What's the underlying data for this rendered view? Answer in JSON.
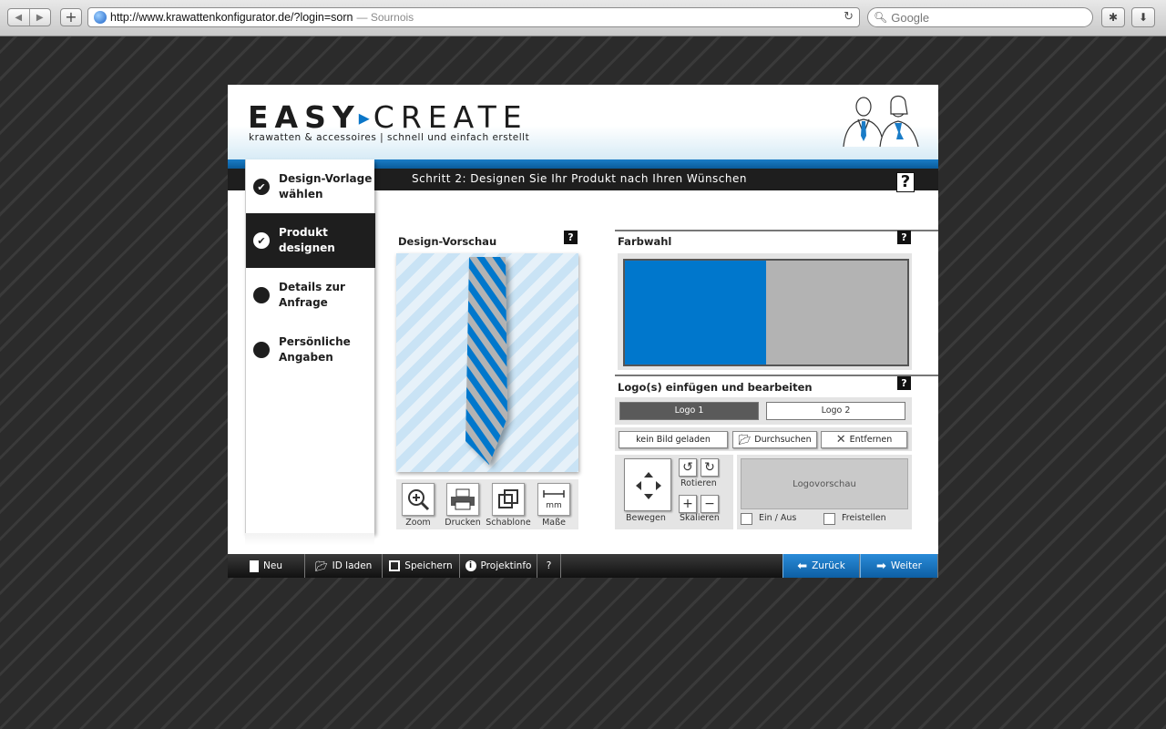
{
  "browser": {
    "url": "http://www.krawattenkonfigurator.de/?login=sorn",
    "title": "— Sournois",
    "search_placeholder": "Google"
  },
  "header": {
    "logo_easy": "EASY",
    "logo_create": "CREATE",
    "tagline": "krawatten & accessoires | schnell und einfach erstellt"
  },
  "step_title": "Schritt 2: Designen Sie Ihr Produkt nach Ihren Wünschen",
  "help_label": "?",
  "sidebar": {
    "items": [
      {
        "label_1": "Design-Vorlage",
        "label_2": "wählen",
        "state": "done"
      },
      {
        "label_1": "Produkt",
        "label_2": "designen",
        "state": "active"
      },
      {
        "label_1": "Details zur",
        "label_2": "Anfrage",
        "state": "pending"
      },
      {
        "label_1": "Persönliche",
        "label_2": "Angaben",
        "state": "pending"
      }
    ]
  },
  "preview": {
    "title": "Design-Vorschau",
    "tools": [
      "Zoom",
      "Drucken",
      "Schablone",
      "Maße"
    ],
    "mm_label": "mm"
  },
  "color": {
    "title": "Farbwahl",
    "swatch_a": "#0077cc",
    "swatch_b": "#b3b3b3"
  },
  "logos": {
    "title": "Logo(s) einfügen und bearbeiten",
    "tab_1": "Logo 1",
    "tab_2": "Logo 2",
    "file_status": "kein Bild geladen",
    "browse": "Durchsuchen",
    "remove": "Entfernen",
    "move": "Bewegen",
    "rotate": "Rotieren",
    "scale": "Skalieren",
    "preview": "Logovorschau",
    "toggle": "Ein / Aus",
    "cutout": "Freistellen"
  },
  "bottom": {
    "new": "Neu",
    "load_id": "ID laden",
    "save": "Speichern",
    "project_info": "Projektinfo",
    "help": "?",
    "back": "Zurück",
    "next": "Weiter"
  }
}
